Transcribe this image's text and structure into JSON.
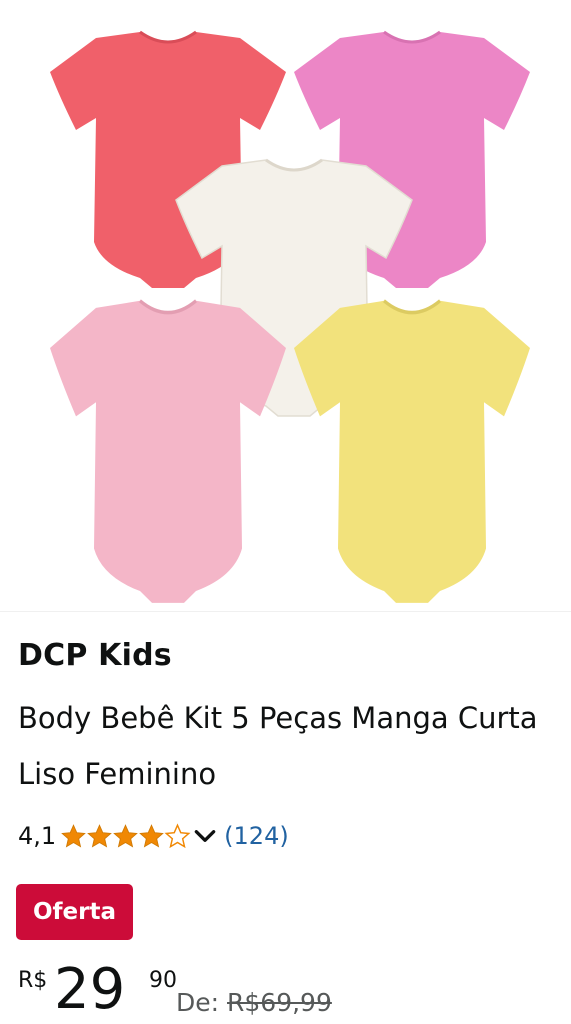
{
  "product": {
    "image_alt": "Kit 5 bodies de bebê: coral, rosa, branco, rosa claro e amarelo",
    "onesie_colors": {
      "coral": "#f0606a",
      "pink": "#ec86c6",
      "white": "#f4f1ea",
      "light_pink": "#f4b6c8",
      "yellow": "#f2e27c"
    },
    "brand": "DCP Kids",
    "title": "Body Bebê Kit 5 Peças Manga Curta Liso Feminino",
    "rating": {
      "value_text": "4,1",
      "stars_filled": 4,
      "stars_half": 0.1,
      "star_color": "#f08804",
      "chevron_icon": "chevron-down-icon",
      "review_count": "(124)"
    },
    "deal_badge": "Oferta",
    "deal_color": "#cc0c39",
    "price": {
      "currency": "R$",
      "whole": "29",
      "fraction": "90",
      "list_label": "De:",
      "list_price": "R$69,99"
    }
  }
}
